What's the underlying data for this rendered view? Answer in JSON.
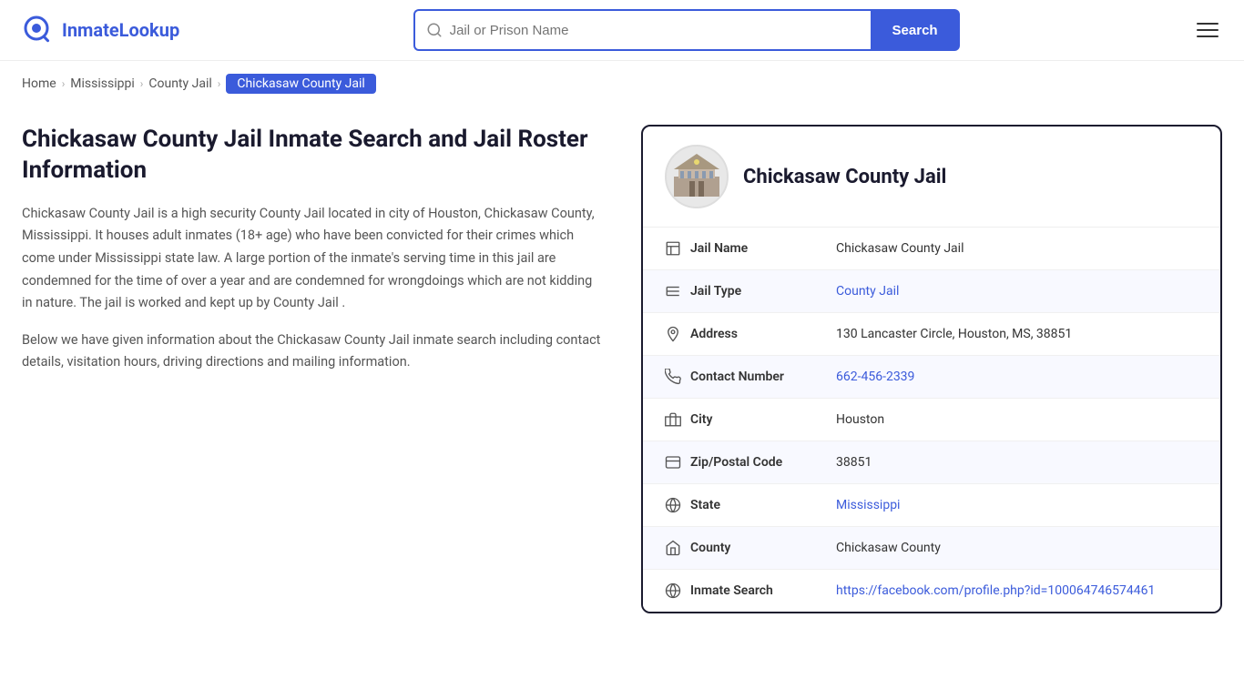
{
  "header": {
    "logo_text_1": "Inmate",
    "logo_text_2": "Lookup",
    "search_placeholder": "Jail or Prison Name",
    "search_button_label": "Search",
    "menu_label": "Menu"
  },
  "breadcrumb": {
    "items": [
      {
        "label": "Home",
        "href": "#"
      },
      {
        "label": "Mississippi",
        "href": "#"
      },
      {
        "label": "County Jail",
        "href": "#"
      },
      {
        "label": "Chickasaw County Jail",
        "current": true
      }
    ]
  },
  "left": {
    "heading": "Chickasaw County Jail Inmate Search and Jail Roster Information",
    "paragraph1": "Chickasaw County Jail is a high security County Jail located in city of Houston, Chickasaw County, Mississippi. It houses adult inmates (18+ age) who have been convicted for their crimes which come under Mississippi state law. A large portion of the inmate's serving time in this jail are condemned for the time of over a year and are condemned for wrongdoings which are not kidding in nature. The jail is worked and kept up by County Jail .",
    "paragraph2": "Below we have given information about the Chickasaw County Jail inmate search including contact details, visitation hours, driving directions and mailing information."
  },
  "card": {
    "title": "Chickasaw County Jail",
    "rows": [
      {
        "icon": "jail-icon",
        "label": "Jail Name",
        "value": "Chickasaw County Jail",
        "link": null
      },
      {
        "icon": "type-icon",
        "label": "Jail Type",
        "value": "County Jail",
        "link": "#"
      },
      {
        "icon": "address-icon",
        "label": "Address",
        "value": "130 Lancaster Circle, Houston, MS, 38851",
        "link": null
      },
      {
        "icon": "phone-icon",
        "label": "Contact Number",
        "value": "662-456-2339",
        "link": "tel:662-456-2339"
      },
      {
        "icon": "city-icon",
        "label": "City",
        "value": "Houston",
        "link": null
      },
      {
        "icon": "zip-icon",
        "label": "Zip/Postal Code",
        "value": "38851",
        "link": null
      },
      {
        "icon": "state-icon",
        "label": "State",
        "value": "Mississippi",
        "link": "#"
      },
      {
        "icon": "county-icon",
        "label": "County",
        "value": "Chickasaw County",
        "link": null
      },
      {
        "icon": "inmate-search-icon",
        "label": "Inmate Search",
        "value": "https://facebook.com/profile.php?id=100064746574461",
        "link": "https://facebook.com/profile.php?id=100064746574461"
      }
    ]
  }
}
